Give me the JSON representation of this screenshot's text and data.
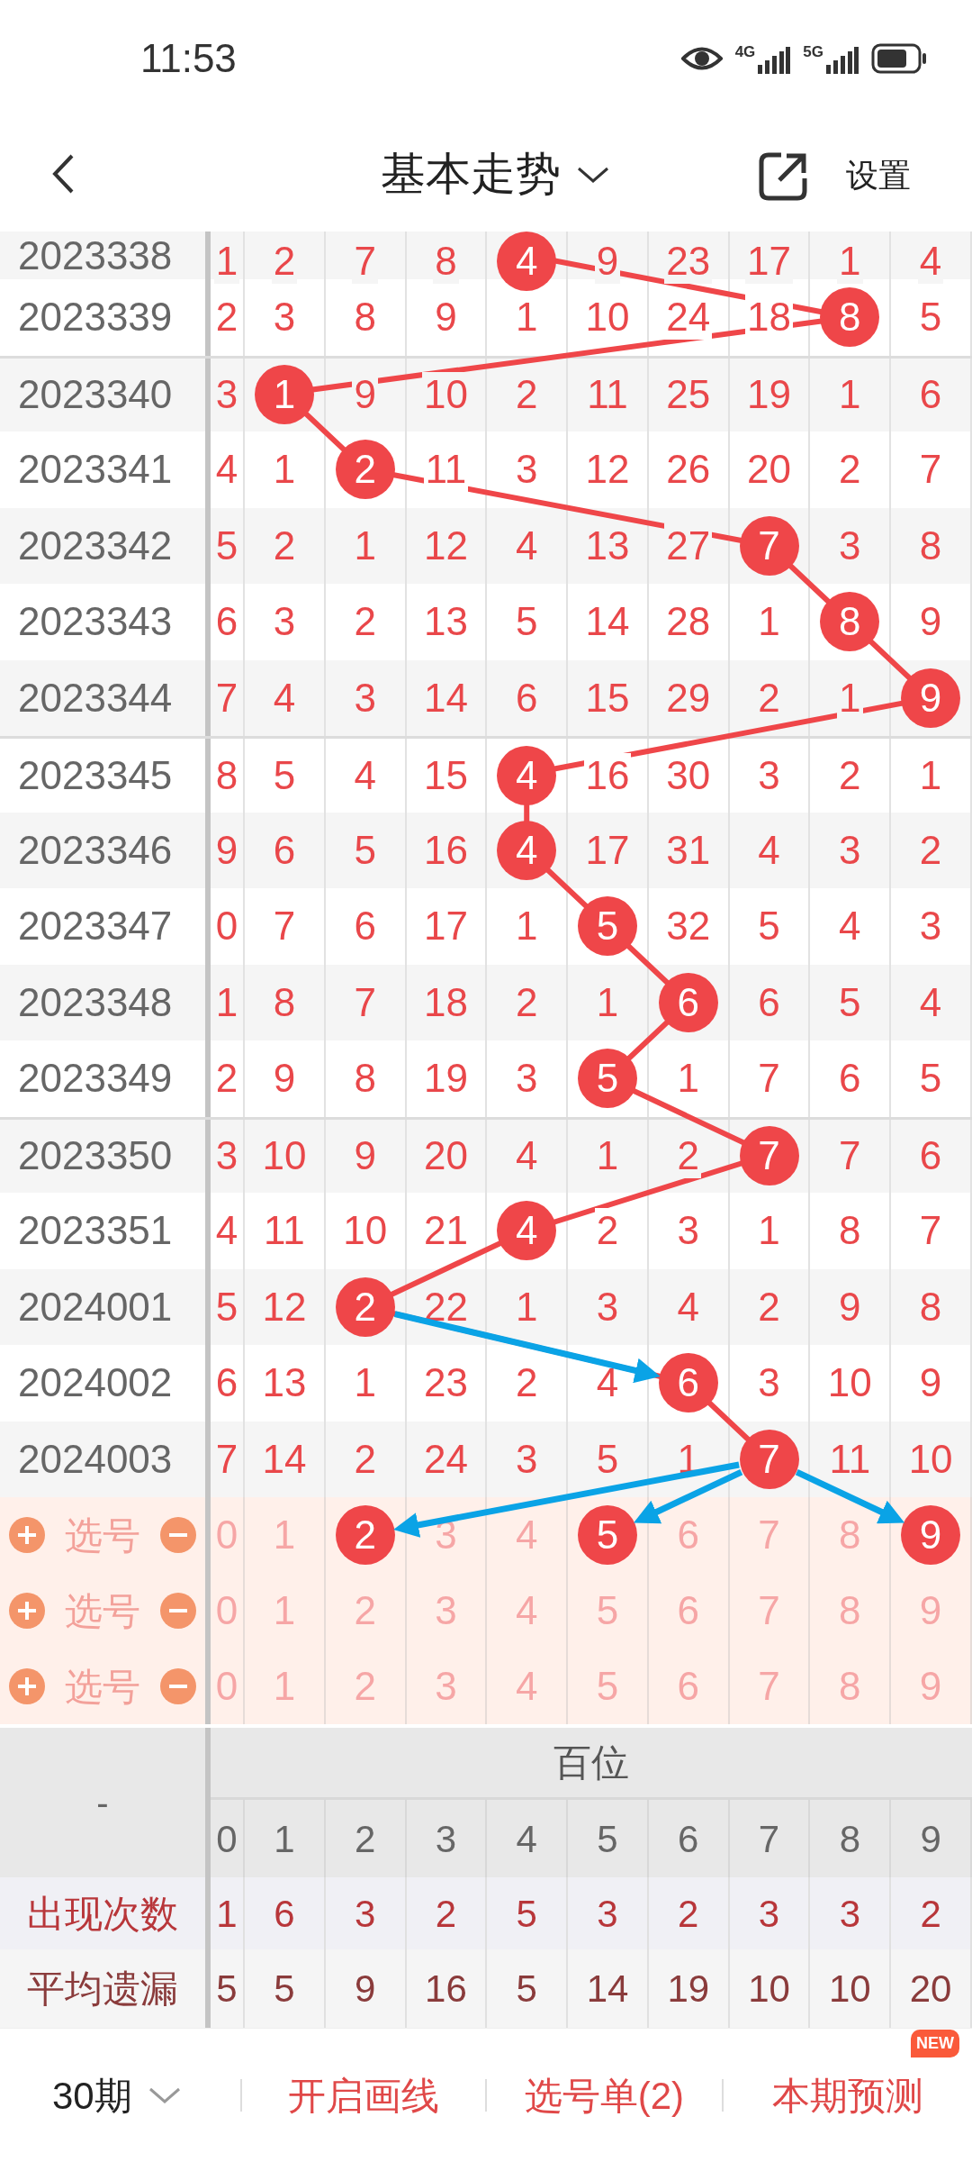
{
  "status_bar": {
    "time": "11:53",
    "network_labels": [
      "4G",
      "5G"
    ]
  },
  "nav": {
    "title": "基本走势",
    "settings": "设置"
  },
  "rows": [
    {
      "period": "2023338",
      "arrow_out": false,
      "cells": [
        {
          "text": "1",
          "hit": false
        },
        {
          "text": "2",
          "hit": false
        },
        {
          "text": "7",
          "hit": false
        },
        {
          "text": "8",
          "hit": false
        },
        {
          "text": "4",
          "hit": true
        },
        {
          "text": "9",
          "hit": false
        },
        {
          "text": "23",
          "hit": false
        },
        {
          "text": "17",
          "hit": false
        },
        {
          "text": "1",
          "hit": false
        },
        {
          "text": "4",
          "hit": false
        }
      ]
    },
    {
      "period": "2023339",
      "arrow_out": false,
      "cells": [
        {
          "text": "2",
          "hit": false
        },
        {
          "text": "3",
          "hit": false
        },
        {
          "text": "8",
          "hit": false
        },
        {
          "text": "9",
          "hit": false
        },
        {
          "text": "1",
          "hit": false
        },
        {
          "text": "10",
          "hit": false
        },
        {
          "text": "24",
          "hit": false
        },
        {
          "text": "18",
          "hit": false
        },
        {
          "text": "8",
          "hit": true
        },
        {
          "text": "5",
          "hit": false
        }
      ]
    },
    {
      "period": "2023340",
      "arrow_out": false,
      "cells": [
        {
          "text": "3",
          "hit": false
        },
        {
          "text": "1",
          "hit": true
        },
        {
          "text": "9",
          "hit": false
        },
        {
          "text": "10",
          "hit": false
        },
        {
          "text": "2",
          "hit": false
        },
        {
          "text": "11",
          "hit": false
        },
        {
          "text": "25",
          "hit": false
        },
        {
          "text": "19",
          "hit": false
        },
        {
          "text": "1",
          "hit": false
        },
        {
          "text": "6",
          "hit": false
        }
      ]
    },
    {
      "period": "2023341",
      "arrow_out": false,
      "cells": [
        {
          "text": "4",
          "hit": false
        },
        {
          "text": "1",
          "hit": false
        },
        {
          "text": "2",
          "hit": true
        },
        {
          "text": "11",
          "hit": false
        },
        {
          "text": "3",
          "hit": false
        },
        {
          "text": "12",
          "hit": false
        },
        {
          "text": "26",
          "hit": false
        },
        {
          "text": "20",
          "hit": false
        },
        {
          "text": "2",
          "hit": false
        },
        {
          "text": "7",
          "hit": false
        }
      ]
    },
    {
      "period": "2023342",
      "arrow_out": false,
      "cells": [
        {
          "text": "5",
          "hit": false
        },
        {
          "text": "2",
          "hit": false
        },
        {
          "text": "1",
          "hit": false
        },
        {
          "text": "12",
          "hit": false
        },
        {
          "text": "4",
          "hit": false
        },
        {
          "text": "13",
          "hit": false
        },
        {
          "text": "27",
          "hit": false
        },
        {
          "text": "7",
          "hit": true
        },
        {
          "text": "3",
          "hit": false
        },
        {
          "text": "8",
          "hit": false
        }
      ]
    },
    {
      "period": "2023343",
      "arrow_out": false,
      "cells": [
        {
          "text": "6",
          "hit": false
        },
        {
          "text": "3",
          "hit": false
        },
        {
          "text": "2",
          "hit": false
        },
        {
          "text": "13",
          "hit": false
        },
        {
          "text": "5",
          "hit": false
        },
        {
          "text": "14",
          "hit": false
        },
        {
          "text": "28",
          "hit": false
        },
        {
          "text": "1",
          "hit": false
        },
        {
          "text": "8",
          "hit": true
        },
        {
          "text": "9",
          "hit": false
        }
      ]
    },
    {
      "period": "2023344",
      "arrow_out": false,
      "cells": [
        {
          "text": "7",
          "hit": false
        },
        {
          "text": "4",
          "hit": false
        },
        {
          "text": "3",
          "hit": false
        },
        {
          "text": "14",
          "hit": false
        },
        {
          "text": "6",
          "hit": false
        },
        {
          "text": "15",
          "hit": false
        },
        {
          "text": "29",
          "hit": false
        },
        {
          "text": "2",
          "hit": false
        },
        {
          "text": "1",
          "hit": false
        },
        {
          "text": "9",
          "hit": true
        }
      ]
    },
    {
      "period": "2023345",
      "arrow_out": false,
      "cells": [
        {
          "text": "8",
          "hit": false
        },
        {
          "text": "5",
          "hit": false
        },
        {
          "text": "4",
          "hit": false
        },
        {
          "text": "15",
          "hit": false
        },
        {
          "text": "4",
          "hit": true
        },
        {
          "text": "16",
          "hit": false
        },
        {
          "text": "30",
          "hit": false
        },
        {
          "text": "3",
          "hit": false
        },
        {
          "text": "2",
          "hit": false
        },
        {
          "text": "1",
          "hit": false
        }
      ]
    },
    {
      "period": "2023346",
      "arrow_out": false,
      "cells": [
        {
          "text": "9",
          "hit": false
        },
        {
          "text": "6",
          "hit": false
        },
        {
          "text": "5",
          "hit": false
        },
        {
          "text": "16",
          "hit": false
        },
        {
          "text": "4",
          "hit": true
        },
        {
          "text": "17",
          "hit": false
        },
        {
          "text": "31",
          "hit": false
        },
        {
          "text": "4",
          "hit": false
        },
        {
          "text": "3",
          "hit": false
        },
        {
          "text": "2",
          "hit": false
        }
      ]
    },
    {
      "period": "2023347",
      "arrow_out": false,
      "cells": [
        {
          "text": "0",
          "hit": false
        },
        {
          "text": "7",
          "hit": false
        },
        {
          "text": "6",
          "hit": false
        },
        {
          "text": "17",
          "hit": false
        },
        {
          "text": "1",
          "hit": false
        },
        {
          "text": "5",
          "hit": true
        },
        {
          "text": "32",
          "hit": false
        },
        {
          "text": "5",
          "hit": false
        },
        {
          "text": "4",
          "hit": false
        },
        {
          "text": "3",
          "hit": false
        }
      ]
    },
    {
      "period": "2023348",
      "arrow_out": false,
      "cells": [
        {
          "text": "1",
          "hit": false
        },
        {
          "text": "8",
          "hit": false
        },
        {
          "text": "7",
          "hit": false
        },
        {
          "text": "18",
          "hit": false
        },
        {
          "text": "2",
          "hit": false
        },
        {
          "text": "1",
          "hit": false
        },
        {
          "text": "6",
          "hit": true
        },
        {
          "text": "6",
          "hit": false
        },
        {
          "text": "5",
          "hit": false
        },
        {
          "text": "4",
          "hit": false
        }
      ]
    },
    {
      "period": "2023349",
      "arrow_out": false,
      "cells": [
        {
          "text": "2",
          "hit": false
        },
        {
          "text": "9",
          "hit": false
        },
        {
          "text": "8",
          "hit": false
        },
        {
          "text": "19",
          "hit": false
        },
        {
          "text": "3",
          "hit": false
        },
        {
          "text": "5",
          "hit": true
        },
        {
          "text": "1",
          "hit": false
        },
        {
          "text": "7",
          "hit": false
        },
        {
          "text": "6",
          "hit": false
        },
        {
          "text": "5",
          "hit": false
        }
      ]
    },
    {
      "period": "2023350",
      "arrow_out": false,
      "cells": [
        {
          "text": "3",
          "hit": false
        },
        {
          "text": "10",
          "hit": false
        },
        {
          "text": "9",
          "hit": false
        },
        {
          "text": "20",
          "hit": false
        },
        {
          "text": "4",
          "hit": false
        },
        {
          "text": "1",
          "hit": false
        },
        {
          "text": "2",
          "hit": false
        },
        {
          "text": "7",
          "hit": true
        },
        {
          "text": "7",
          "hit": false
        },
        {
          "text": "6",
          "hit": false
        }
      ]
    },
    {
      "period": "2023351",
      "arrow_out": false,
      "cells": [
        {
          "text": "4",
          "hit": false
        },
        {
          "text": "11",
          "hit": false
        },
        {
          "text": "10",
          "hit": false
        },
        {
          "text": "21",
          "hit": false
        },
        {
          "text": "4",
          "hit": true
        },
        {
          "text": "2",
          "hit": false
        },
        {
          "text": "3",
          "hit": false
        },
        {
          "text": "1",
          "hit": false
        },
        {
          "text": "8",
          "hit": false
        },
        {
          "text": "7",
          "hit": false
        }
      ]
    },
    {
      "period": "2024001",
      "arrow_out": true,
      "cells": [
        {
          "text": "5",
          "hit": false
        },
        {
          "text": "12",
          "hit": false
        },
        {
          "text": "2",
          "hit": true
        },
        {
          "text": "22",
          "hit": false
        },
        {
          "text": "1",
          "hit": false
        },
        {
          "text": "3",
          "hit": false
        },
        {
          "text": "4",
          "hit": false
        },
        {
          "text": "2",
          "hit": false
        },
        {
          "text": "9",
          "hit": false
        },
        {
          "text": "8",
          "hit": false
        }
      ]
    },
    {
      "period": "2024002",
      "arrow_out": false,
      "cells": [
        {
          "text": "6",
          "hit": false
        },
        {
          "text": "13",
          "hit": false
        },
        {
          "text": "1",
          "hit": false
        },
        {
          "text": "23",
          "hit": false
        },
        {
          "text": "2",
          "hit": false
        },
        {
          "text": "4",
          "hit": false
        },
        {
          "text": "6",
          "hit": true
        },
        {
          "text": "3",
          "hit": false
        },
        {
          "text": "10",
          "hit": false
        },
        {
          "text": "9",
          "hit": false
        }
      ]
    },
    {
      "period": "2024003",
      "arrow_out": true,
      "cells": [
        {
          "text": "7",
          "hit": false
        },
        {
          "text": "14",
          "hit": false
        },
        {
          "text": "2",
          "hit": false
        },
        {
          "text": "24",
          "hit": false
        },
        {
          "text": "3",
          "hit": false
        },
        {
          "text": "5",
          "hit": false
        },
        {
          "text": "1",
          "hit": false
        },
        {
          "text": "7",
          "hit": true
        },
        {
          "text": "11",
          "hit": false
        },
        {
          "text": "10",
          "hit": false
        }
      ]
    }
  ],
  "pick_rows": [
    {
      "label": "选号",
      "cells": [
        {
          "text": "0",
          "picked": false
        },
        {
          "text": "1",
          "picked": false
        },
        {
          "text": "2",
          "picked": true
        },
        {
          "text": "3",
          "picked": false
        },
        {
          "text": "4",
          "picked": false
        },
        {
          "text": "5",
          "picked": true
        },
        {
          "text": "6",
          "picked": false
        },
        {
          "text": "7",
          "picked": false
        },
        {
          "text": "8",
          "picked": false
        },
        {
          "text": "9",
          "picked": true
        }
      ]
    },
    {
      "label": "选号",
      "cells": [
        {
          "text": "0",
          "picked": false
        },
        {
          "text": "1",
          "picked": false
        },
        {
          "text": "2",
          "picked": false
        },
        {
          "text": "3",
          "picked": false
        },
        {
          "text": "4",
          "picked": false
        },
        {
          "text": "5",
          "picked": false
        },
        {
          "text": "6",
          "picked": false
        },
        {
          "text": "7",
          "picked": false
        },
        {
          "text": "8",
          "picked": false
        },
        {
          "text": "9",
          "picked": false
        }
      ]
    },
    {
      "label": "选号",
      "cells": [
        {
          "text": "0",
          "picked": false
        },
        {
          "text": "1",
          "picked": false
        },
        {
          "text": "2",
          "picked": false
        },
        {
          "text": "3",
          "picked": false
        },
        {
          "text": "4",
          "picked": false
        },
        {
          "text": "5",
          "picked": false
        },
        {
          "text": "6",
          "picked": false
        },
        {
          "text": "7",
          "picked": false
        },
        {
          "text": "8",
          "picked": false
        },
        {
          "text": "9",
          "picked": false
        }
      ]
    }
  ],
  "footer": {
    "corner": "-",
    "group": "百位",
    "digits": [
      "0",
      "1",
      "2",
      "3",
      "4",
      "5",
      "6",
      "7",
      "8",
      "9"
    ],
    "stats": [
      {
        "label": "出现次数",
        "values": [
          "1",
          "6",
          "3",
          "2",
          "5",
          "3",
          "2",
          "3",
          "3",
          "2"
        ]
      },
      {
        "label": "平均遗漏",
        "values": [
          "5",
          "5",
          "9",
          "16",
          "5",
          "14",
          "19",
          "10",
          "10",
          "20"
        ]
      }
    ]
  },
  "bottom_bar": {
    "period_select": "30期",
    "actions": [
      {
        "label": "开启画线"
      },
      {
        "label": "选号单(2)"
      },
      {
        "label": "本期预测",
        "badge": "NEW"
      }
    ]
  }
}
